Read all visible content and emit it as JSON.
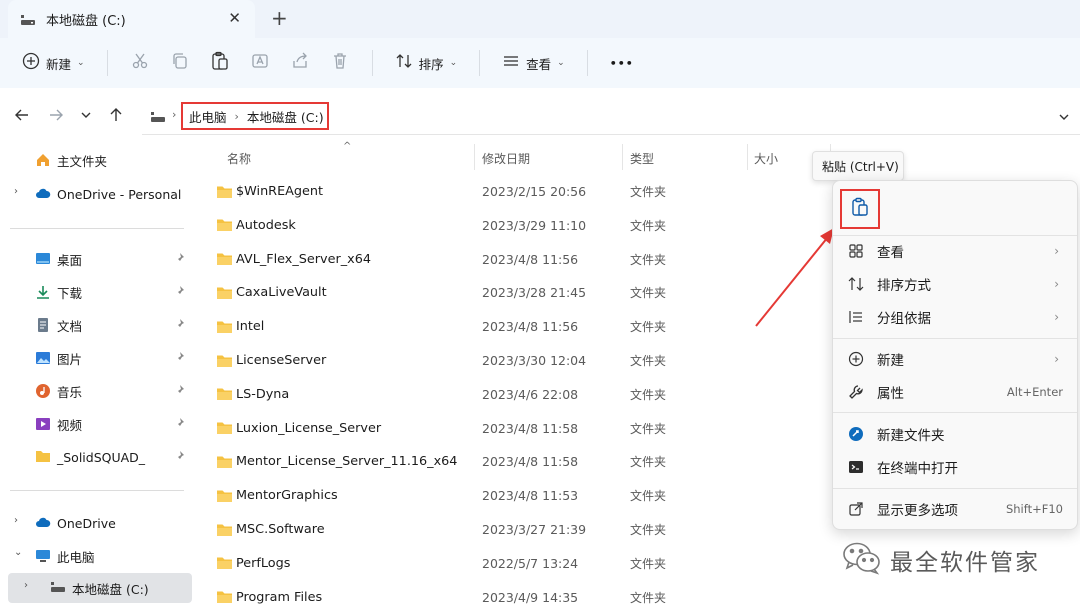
{
  "window": {
    "tab_title": "本地磁盘 (C:)",
    "tab_close": "✕",
    "new_tab": "+"
  },
  "toolbar": {
    "new_label": "新建",
    "sort_label": "排序",
    "view_label": "查看",
    "more": "•••"
  },
  "address": {
    "crumbs": [
      "此电脑",
      "本地磁盘 (C:)"
    ],
    "sep": "›"
  },
  "sidebar": {
    "home": "主文件夹",
    "onedrive_personal": "OneDrive - Personal",
    "quick": [
      {
        "label": "桌面",
        "icon": "desktop-icon",
        "color": "#2b88d8"
      },
      {
        "label": "下载",
        "icon": "download-icon",
        "color": "#1a8a5a"
      },
      {
        "label": "文档",
        "icon": "document-icon",
        "color": "#6b7b8c"
      },
      {
        "label": "图片",
        "icon": "pictures-icon",
        "color": "#2b7bd8"
      },
      {
        "label": "音乐",
        "icon": "music-icon",
        "color": "#e0642f"
      },
      {
        "label": "视频",
        "icon": "video-icon",
        "color": "#8a3fbf"
      },
      {
        "label": "_SolidSQUAD_",
        "icon": "folder-icon",
        "color": "#f5c242"
      }
    ],
    "onedrive": "OneDrive",
    "this_pc": "此电脑",
    "local_disk": "本地磁盘 (C:)"
  },
  "columns": {
    "name": "名称",
    "date": "修改日期",
    "type": "类型",
    "size": "大小"
  },
  "files": [
    {
      "name": "$WinREAgent",
      "date": "2023/2/15 20:56",
      "type": "文件夹"
    },
    {
      "name": "Autodesk",
      "date": "2023/3/29 11:10",
      "type": "文件夹"
    },
    {
      "name": "AVL_Flex_Server_x64",
      "date": "2023/4/8 11:56",
      "type": "文件夹"
    },
    {
      "name": "CaxaLiveVault",
      "date": "2023/3/28 21:45",
      "type": "文件夹"
    },
    {
      "name": "Intel",
      "date": "2023/4/8 11:56",
      "type": "文件夹"
    },
    {
      "name": "LicenseServer",
      "date": "2023/3/30 12:04",
      "type": "文件夹"
    },
    {
      "name": "LS-Dyna",
      "date": "2023/4/6 22:08",
      "type": "文件夹"
    },
    {
      "name": "Luxion_License_Server",
      "date": "2023/4/8 11:58",
      "type": "文件夹"
    },
    {
      "name": "Mentor_License_Server_11.16_x64",
      "date": "2023/4/8 11:58",
      "type": "文件夹"
    },
    {
      "name": "MentorGraphics",
      "date": "2023/4/8 11:53",
      "type": "文件夹"
    },
    {
      "name": "MSC.Software",
      "date": "2023/3/27 21:39",
      "type": "文件夹"
    },
    {
      "name": "PerfLogs",
      "date": "2022/5/7 13:24",
      "type": "文件夹"
    },
    {
      "name": "Program Files",
      "date": "2023/4/9 14:35",
      "type": "文件夹"
    }
  ],
  "context_menu": {
    "tooltip": "粘贴 (Ctrl+V)",
    "view": "查看",
    "sort_by": "排序方式",
    "group_by": "分组依据",
    "new": "新建",
    "properties": "属性",
    "properties_shortcut": "Alt+Enter",
    "new_folder": "新建文件夹",
    "open_terminal": "在终端中打开",
    "more_options": "显示更多选项",
    "more_options_shortcut": "Shift+F10",
    "submenu_arrow": "›"
  },
  "watermark": {
    "text": "最全软件管家"
  },
  "colors": {
    "highlight_red": "#e53935",
    "folder_yellow": "#f5c242",
    "accent_blue": "#0067c0"
  }
}
